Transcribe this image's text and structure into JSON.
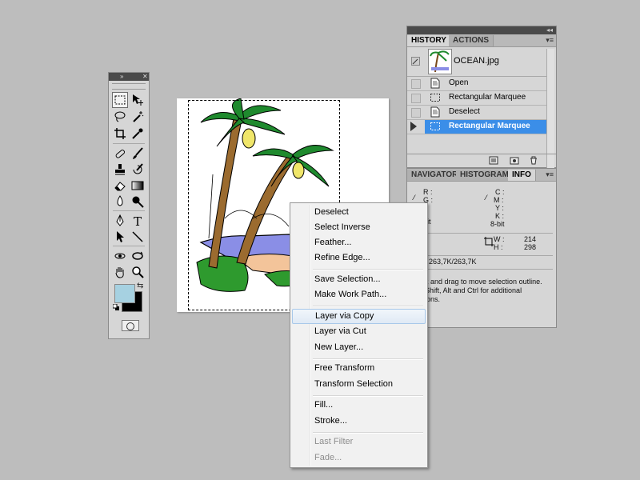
{
  "history_panel": {
    "tabs": [
      "HISTORY",
      "ACTIONS"
    ],
    "snapshot_name": "OCEAN.jpg",
    "states": [
      {
        "label": "Open",
        "icon": "document-icon"
      },
      {
        "label": "Rectangular Marquee",
        "icon": "marquee-icon"
      },
      {
        "label": "Deselect",
        "icon": "document-icon"
      },
      {
        "label": "Rectangular Marquee",
        "icon": "marquee-icon",
        "selected": true
      }
    ]
  },
  "info_panel": {
    "tabs": [
      "NAVIGATOR",
      "HISTOGRAM",
      "INFO"
    ],
    "rgb_labels": [
      "R :",
      "G :",
      ":"
    ],
    "bit_left": "bit",
    "cmyk_labels": [
      "C :",
      "M :",
      "Y :",
      "K :"
    ],
    "bit_right": "8-bit",
    "xy_labels": [
      ":",
      ":"
    ],
    "wh_labels": [
      "W :",
      "H :"
    ],
    "width": "214",
    "height": "298",
    "doc_size": ": 263,7K/263,7K",
    "hint_lines": [
      "k and drag to move selection outline.",
      "Shift, Alt and Ctrl for additional",
      "ions."
    ]
  },
  "context_menu": {
    "groups": [
      [
        {
          "label": "Deselect"
        },
        {
          "label": "Select Inverse"
        },
        {
          "label": "Feather..."
        },
        {
          "label": "Refine Edge..."
        }
      ],
      [
        {
          "label": "Save Selection..."
        },
        {
          "label": "Make Work Path..."
        }
      ],
      [
        {
          "label": "Layer via Copy",
          "hover": true
        },
        {
          "label": "Layer via Cut"
        },
        {
          "label": "New Layer..."
        }
      ],
      [
        {
          "label": "Free Transform"
        },
        {
          "label": "Transform Selection"
        }
      ],
      [
        {
          "label": "Fill..."
        },
        {
          "label": "Stroke..."
        }
      ],
      [
        {
          "label": "Last Filter",
          "disabled": true
        },
        {
          "label": "Fade...",
          "disabled": true
        }
      ]
    ]
  },
  "colors": {
    "foreground": "#a6d1e1",
    "background": "#000000",
    "selection_highlight": "#3b8ee8"
  }
}
